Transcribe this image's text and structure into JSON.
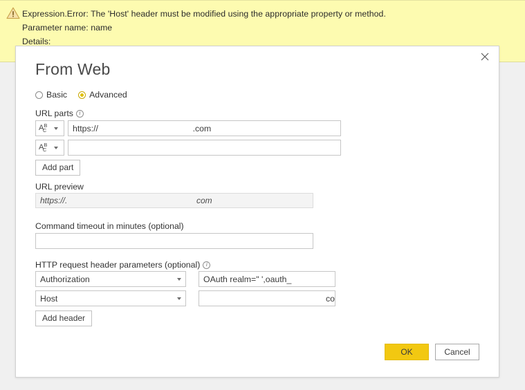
{
  "banner": {
    "icon": "warning-triangle-icon",
    "lines": [
      "Expression.Error: The 'Host' header must be modified using the appropriate property or method.",
      "Parameter name: name",
      "Details:"
    ],
    "background_color": "#FDFBB0"
  },
  "dialog": {
    "title": "From Web",
    "close_label": "✕",
    "mode": {
      "options": [
        {
          "label": "Basic",
          "selected": false
        },
        {
          "label": "Advanced",
          "selected": true
        }
      ],
      "accent_color": "#E0C000"
    },
    "url_parts": {
      "label": "URL parts",
      "info_icon": "info-icon",
      "type_glyph": {
        "a": "A",
        "b": "B",
        "c": "C"
      },
      "rows": [
        {
          "type": "Text",
          "value": "https://                                        .com"
        },
        {
          "type": "Text",
          "value": ""
        }
      ],
      "add_button": "Add part"
    },
    "url_preview": {
      "label": "URL preview",
      "prefix": "https://.",
      "suffix": "com"
    },
    "command_timeout": {
      "label": "Command timeout in minutes (optional)",
      "value": "",
      "placeholder": ""
    },
    "http_headers": {
      "label": "HTTP request header parameters (optional)",
      "info_icon": "info-icon",
      "rows": [
        {
          "name": "Authorization",
          "value": "OAuth realm=\"                         ',oauth_"
        },
        {
          "name": "Host",
          "value": "co"
        }
      ],
      "add_button": "Add header"
    },
    "footer": {
      "ok_label": "OK",
      "cancel_label": "Cancel",
      "ok_color": "#F2C811"
    }
  }
}
